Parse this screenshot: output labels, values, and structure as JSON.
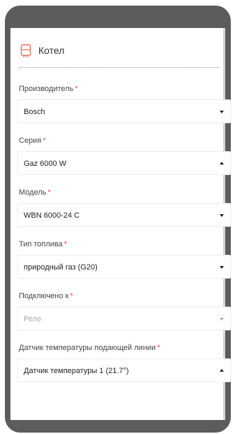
{
  "header": {
    "title": "Котел",
    "icon": "boiler-icon",
    "icon_color": "#e8735a"
  },
  "fields": [
    {
      "label": "Производитель",
      "value": "Bosch",
      "arrow": "down",
      "disabled": false
    },
    {
      "label": "Серия",
      "value": "Gaz 6000 W",
      "arrow": "up",
      "disabled": false
    },
    {
      "label": "Модель",
      "value": "WBN 6000-24 C",
      "arrow": "down",
      "disabled": false
    },
    {
      "label": "Тип топлива",
      "value": "природный газ (G20)",
      "arrow": "down",
      "disabled": false
    },
    {
      "label": "Подключено к",
      "value": "Реле",
      "arrow": "down",
      "disabled": true
    },
    {
      "label": "Датчик температуры подающей линии",
      "value": "Датчик температуры 1 (21.7°)",
      "arrow": "up",
      "disabled": false
    }
  ],
  "required_mark": "*",
  "colors": {
    "required": "#e5484d",
    "frame": "#5c5c5c"
  }
}
